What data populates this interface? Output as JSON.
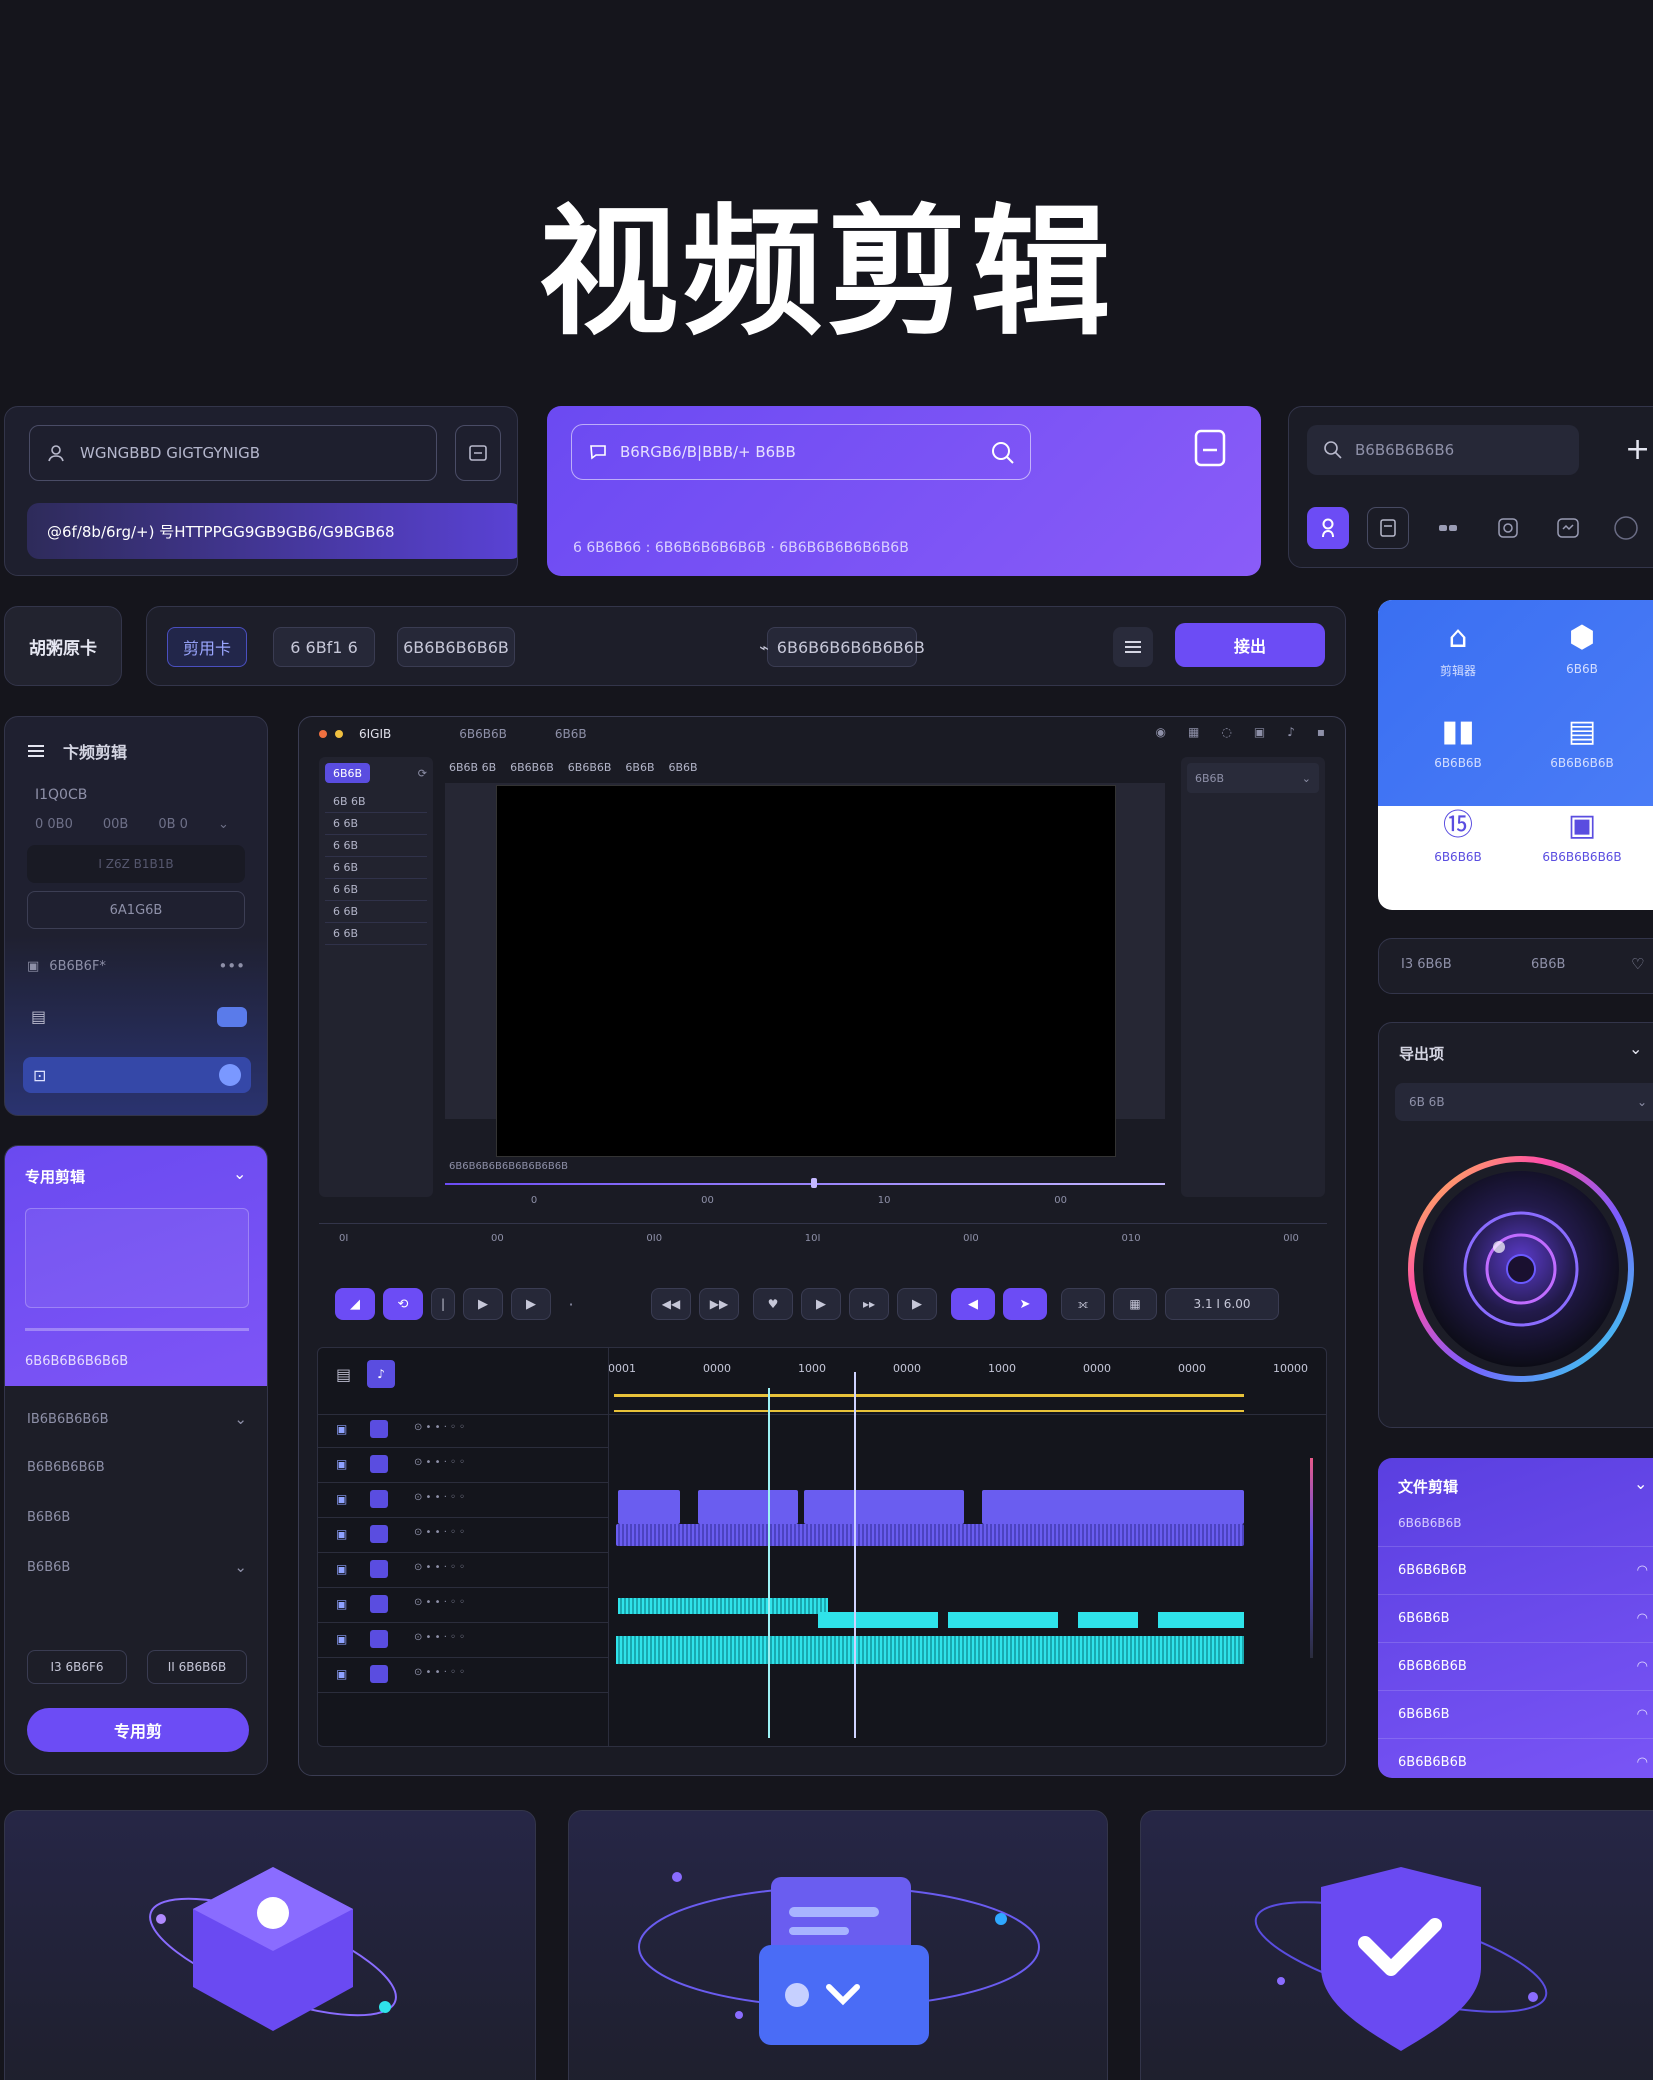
{
  "page_title": "视频剪辑",
  "top_left_card": {
    "search_placeholder": "WGNGBBD GIGTGYNIGB",
    "banner_text": "@6f/8b/6rg/+) 号HTTPPGG9GB9GB6/G9BGB68"
  },
  "top_mid_card": {
    "search_placeholder": "B6RGB6/B|BBB/+ B6BB",
    "footer_text": "6 6B6B66 : 6B6B6B6B6B6B · 6B6B6B6B6B6B6B"
  },
  "top_right_card": {
    "search_placeholder": "B6B6B6B6B6"
  },
  "nav": {
    "logo": "胡粥原卡",
    "tab_active": "剪用卡",
    "tab_2": "6 6Bf1 6",
    "tab_3": "6B6B6B6B6B",
    "search_text": "6B6B6B6B6B6B6B",
    "export_label": "接出"
  },
  "left_panel": {
    "title": "卞频剪辑",
    "subtitle": "I1Q0CB",
    "meta_1": "0 0B0",
    "meta_2": "00B",
    "meta_3": "0B 0",
    "field_text": "I Z6Z  B1B1B",
    "button_text": "6A1G6B",
    "row_1": "6B6B6F*",
    "menu": "•••"
  },
  "effects_panel": {
    "title": "专用剪辑",
    "progress_label": "6B6B6B6B6B6B",
    "item_1": "IB6B6B6B6B",
    "item_2": "B6B6B6B6B",
    "item_3": "B6B6B",
    "item_4": "B6B6B",
    "btn_left": "I3 6B6F6",
    "btn_right": "II 6B6B6B",
    "apply_label": "专用剪"
  },
  "editor": {
    "title": "6IGIB",
    "menu_1": "6B6B6B",
    "menu_2": "6B6B",
    "left_tab": "6B6B",
    "list": [
      "6B 6B",
      "6 6B",
      "6 6B",
      "6 6B",
      "6 6B",
      "6 6B",
      "6 6B"
    ],
    "toolbar": [
      "6B6B 6B",
      "6B6B6B",
      "6B6B6B",
      "6B6B",
      "6B6B"
    ],
    "right_dropdown": "6B6B",
    "preview_caption": "6B6B6B6B6B6B6B6B6B",
    "ruler_1": [
      "0",
      "00",
      "10",
      "00"
    ],
    "ruler_2": [
      "0I",
      "00",
      "0I0",
      "10I",
      "0I0",
      "010",
      "0I0"
    ],
    "timecode": "3.1 I 6.00",
    "time_ticks": [
      "0001",
      "0000",
      "1000",
      "0000",
      "1000",
      "0000",
      "0000",
      "10000"
    ]
  },
  "tools_card": {
    "items": [
      {
        "label": "剪辑器"
      },
      {
        "label": "6B6B"
      },
      {
        "label": "6B6B6B"
      },
      {
        "label": "6B6B6B6B"
      },
      {
        "label": "6B6B6B"
      },
      {
        "label": "6B6B6B6B6B"
      }
    ]
  },
  "chip_row": {
    "left": "I3 6B6B",
    "mid": "6B6B"
  },
  "camera_card": {
    "title": "导出项",
    "dropdown": "6B 6B"
  },
  "list_card": {
    "title": "文件剪辑",
    "subtitle": "6B6B6B6B",
    "items": [
      "6B6B6B6B",
      "6B6B6B",
      "6B6B6B6B",
      "6B6B6B",
      "6B6B6B6B"
    ]
  },
  "colors": {
    "accent": "#6c4cf5",
    "cyan": "#2fe3ea",
    "yellow": "#e8c23a",
    "bg": "#15151c"
  }
}
